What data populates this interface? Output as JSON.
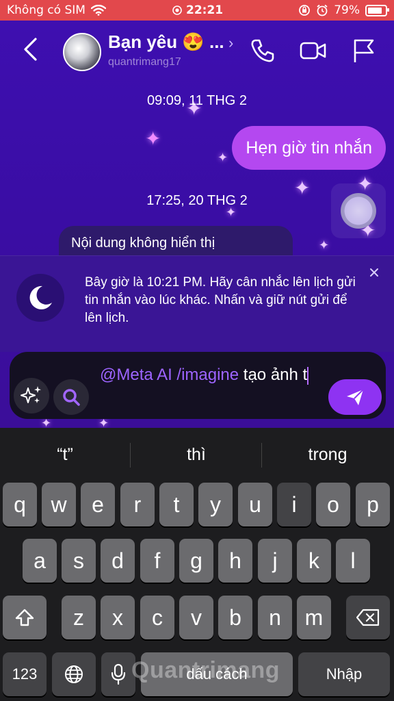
{
  "status_bar": {
    "carrier": "Không có SIM",
    "time": "22:21",
    "battery_percent": "79%"
  },
  "header": {
    "contact_name": "Bạn yêu 😍 ...",
    "username": "quantrimang17",
    "back_icon": "chevron-left-icon",
    "call_icon": "phone-icon",
    "video_icon": "video-camera-icon",
    "flag_icon": "flag-icon"
  },
  "messages": {
    "date_1": "09:09, 11 THG 2",
    "outgoing_1": "Hẹn giờ tin nhắn",
    "date_2": "17:25, 20 THG 2",
    "incoming_1": "Nội dung không hiển thị"
  },
  "notice": {
    "text": "Bây giờ là 10:21 PM. Hãy cân nhắc lên lịch gửi tin nhắn vào lúc khác. Nhấn và giữ nút gửi để lên lịch."
  },
  "composer": {
    "mention": "@Meta AI /imagine",
    "text_after_mention": " tạo ảnh t"
  },
  "keyboard": {
    "suggestions": [
      "“t”",
      "thì",
      "trong"
    ],
    "row1": [
      "q",
      "w",
      "e",
      "r",
      "t",
      "y",
      "u",
      "i",
      "o",
      "p"
    ],
    "row2": [
      "a",
      "s",
      "d",
      "f",
      "g",
      "h",
      "j",
      "k",
      "l"
    ],
    "row3": [
      "z",
      "x",
      "c",
      "v",
      "b",
      "n",
      "m"
    ],
    "numbers_key": "123",
    "space_key": "dấu cách",
    "return_key": "Nhập"
  },
  "watermark": "Quantrimang",
  "colors": {
    "status_bar": "#e2484c",
    "chat_bg": "#3e0fb0",
    "outgoing_bubble": "#b448f0",
    "send_button": "#8e33f2",
    "mention": "#9d64ff"
  }
}
